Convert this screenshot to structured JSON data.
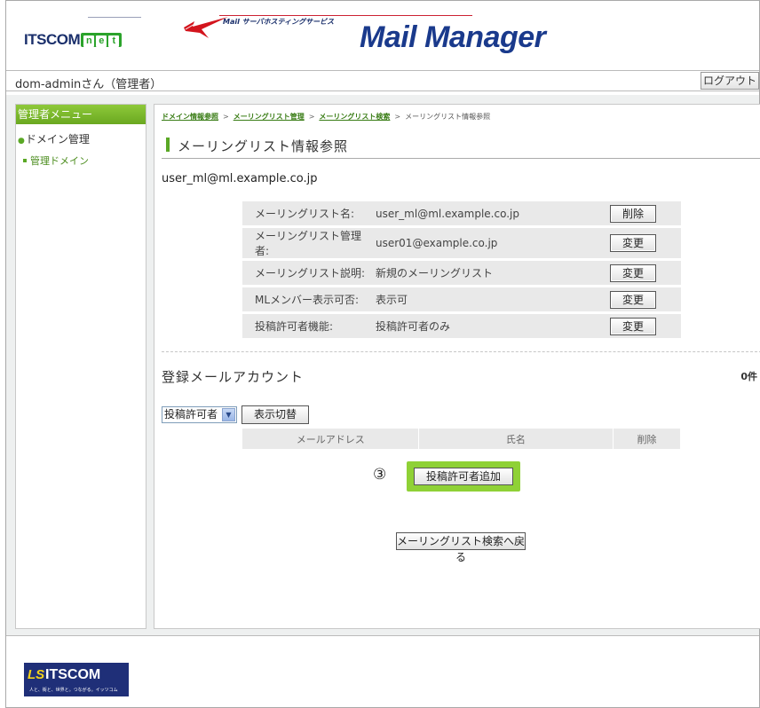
{
  "header": {
    "brand": "ITSCOM",
    "brand_net": [
      "n",
      "e",
      "t"
    ],
    "service_subtitle": "Mail サーバホスティングサービス",
    "app_title": "Mail Manager"
  },
  "userbar": {
    "user": "dom-adminさん（管理者）",
    "logout_label": "ログアウト"
  },
  "sidebar": {
    "menu_title": "管理者メニュー",
    "item": "ドメイン管理",
    "sub_item": "管理ドメイン"
  },
  "breadcrumb": {
    "items": [
      "ドメイン情報参照",
      "メーリングリスト管理",
      "メーリングリスト検索"
    ],
    "separator": ">",
    "current": "メーリングリスト情報参照"
  },
  "page": {
    "title": "メーリングリスト情報参照",
    "ml_address": "user_ml@ml.example.co.jp"
  },
  "info_rows": [
    {
      "label": "メーリングリスト名:",
      "value": "user_ml@ml.example.co.jp",
      "action": "削除"
    },
    {
      "label": "メーリングリスト管理者:",
      "value": "user01@example.co.jp",
      "action": "変更"
    },
    {
      "label": "メーリングリスト説明:",
      "value": "新規のメーリングリスト",
      "action": "変更"
    },
    {
      "label": "MLメンバー表示可否:",
      "value": "表示可",
      "action": "変更"
    },
    {
      "label": "投稿許可者機能:",
      "value": "投稿許可者のみ",
      "action": "変更"
    }
  ],
  "accounts": {
    "section_title": "登録メールアカウント",
    "count": "0件",
    "filter_selected": "投稿許可者",
    "toggle_label": "表示切替",
    "columns": [
      "メールアドレス",
      "氏名",
      "削除"
    ],
    "step_marker": "③",
    "add_label": "投稿許可者追加"
  },
  "back_label": "メーリングリスト検索へ戻る",
  "footer": {
    "brand": "ITSCOM",
    "mark": "LS",
    "tagline": "人と、街と、世界と。つながる。イッツコム"
  },
  "colors": {
    "accent_green": "#6aa820",
    "highlight_green": "#8fd136",
    "brand_navy": "#1a3a8c",
    "table_gray": "#e9e9e9"
  }
}
